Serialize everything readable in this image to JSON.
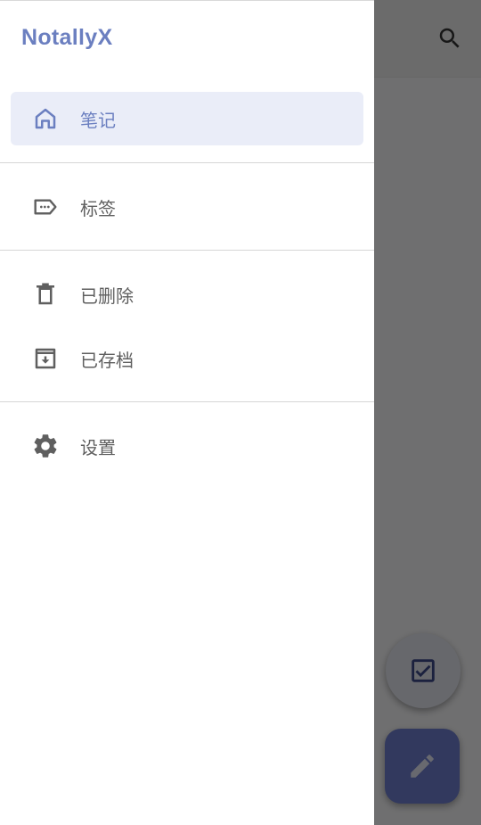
{
  "app": {
    "title": "NotallyX"
  },
  "drawer": {
    "items": [
      {
        "label": "笔记",
        "icon": "home-icon",
        "active": true
      },
      {
        "label": "标签",
        "icon": "label-icon",
        "active": false
      },
      {
        "label": "已删除",
        "icon": "trash-icon",
        "active": false
      },
      {
        "label": "已存档",
        "icon": "archive-icon",
        "active": false
      },
      {
        "label": "设置",
        "icon": "settings-icon",
        "active": false
      }
    ]
  },
  "colors": {
    "accent": "#6b7fc0",
    "active_bg": "#eaedf8",
    "text": "#5f5f5f",
    "fab": "#6f7fd0"
  },
  "background": {
    "search_icon": "search-icon",
    "fab_checklist_icon": "checkbox-icon",
    "fab_note_icon": "pencil-icon"
  }
}
